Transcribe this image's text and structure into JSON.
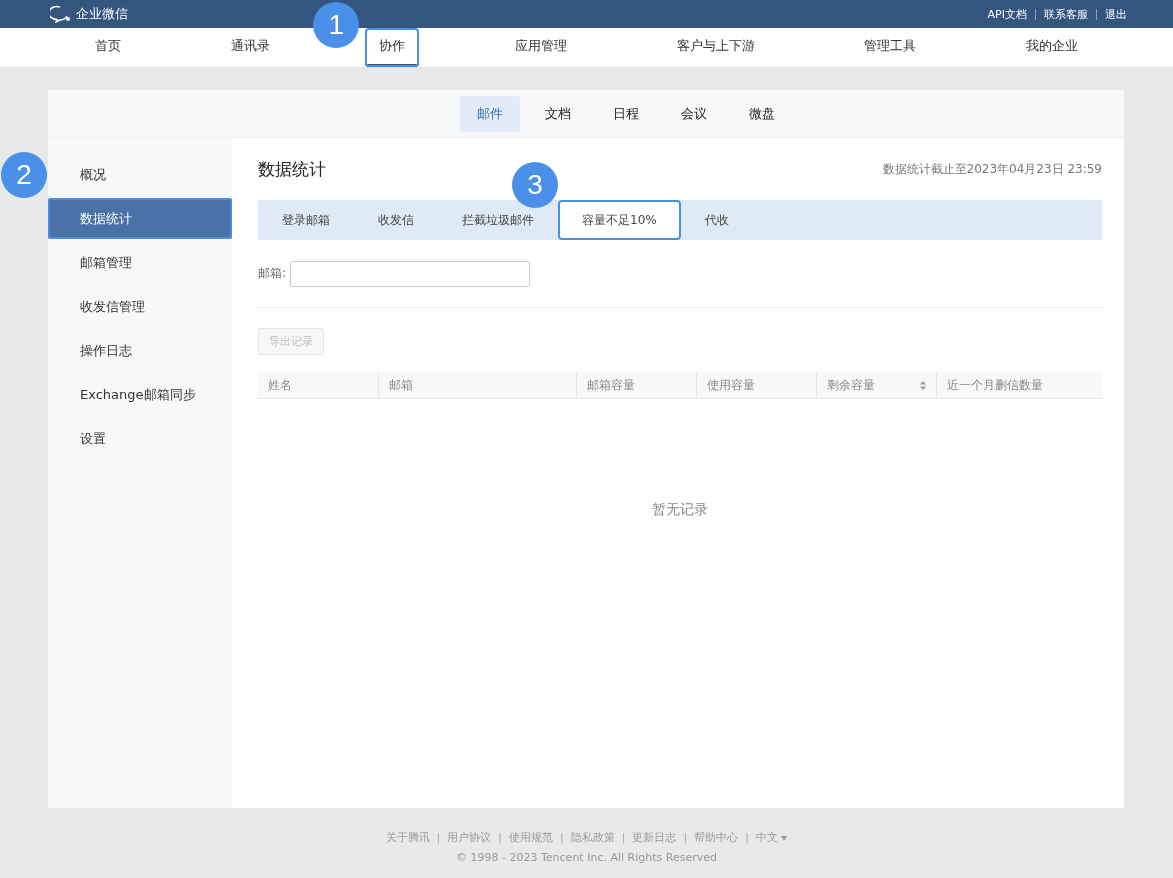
{
  "header": {
    "logo": "企业微信",
    "links": [
      "API文档",
      "联系客服",
      "退出"
    ]
  },
  "nav": [
    {
      "label": "首页",
      "selected": false
    },
    {
      "label": "通讯录",
      "selected": false
    },
    {
      "label": "协作",
      "selected": true,
      "callout": "1"
    },
    {
      "label": "应用管理",
      "selected": false
    },
    {
      "label": "客户与上下游",
      "selected": false
    },
    {
      "label": "管理工具",
      "selected": false
    },
    {
      "label": "我的企业",
      "selected": false
    }
  ],
  "subtabs": [
    {
      "label": "邮件",
      "selected": true
    },
    {
      "label": "文档",
      "selected": false
    },
    {
      "label": "日程",
      "selected": false
    },
    {
      "label": "会议",
      "selected": false
    },
    {
      "label": "微盘",
      "selected": false
    }
  ],
  "sidebar": {
    "items": [
      {
        "label": "概况",
        "selected": false
      },
      {
        "label": "数据统计",
        "selected": true,
        "callout": "2"
      },
      {
        "label": "邮箱管理",
        "selected": false
      },
      {
        "label": "收发信管理",
        "selected": false
      },
      {
        "label": "操作日志",
        "selected": false
      },
      {
        "label": "Exchange邮箱同步",
        "selected": false
      },
      {
        "label": "设置",
        "selected": false
      }
    ]
  },
  "main": {
    "title": "数据统计",
    "timestamp": "数据统计截止至2023年04月23日 23:59",
    "tabs": [
      {
        "label": "登录邮箱",
        "selected": false
      },
      {
        "label": "收发信",
        "selected": false
      },
      {
        "label": "拦截垃圾邮件",
        "selected": false
      },
      {
        "label": "容量不足10%",
        "selected": true,
        "callout": "3"
      },
      {
        "label": "代收",
        "selected": false
      }
    ],
    "filter": {
      "label": "邮箱:"
    },
    "export_button": {
      "label": "导出记录",
      "disabled": true
    },
    "table": {
      "columns": [
        {
          "label": "姓名",
          "sortable": false
        },
        {
          "label": "邮箱",
          "sortable": false
        },
        {
          "label": "邮箱容量",
          "sortable": false
        },
        {
          "label": "使用容量",
          "sortable": false
        },
        {
          "label": "剩余容量",
          "sortable": true
        },
        {
          "label": "近一个月删信数量",
          "sortable": false
        }
      ],
      "empty": "暂无记录"
    }
  },
  "footer": {
    "separator": "|",
    "links": [
      "关于腾讯",
      "用户协议",
      "使用规范",
      "隐私政策",
      "更新日志",
      "帮助中心"
    ],
    "language": "中文",
    "copyright": "© 1998 - 2023 Tencent Inc. All Rights Reserved"
  }
}
